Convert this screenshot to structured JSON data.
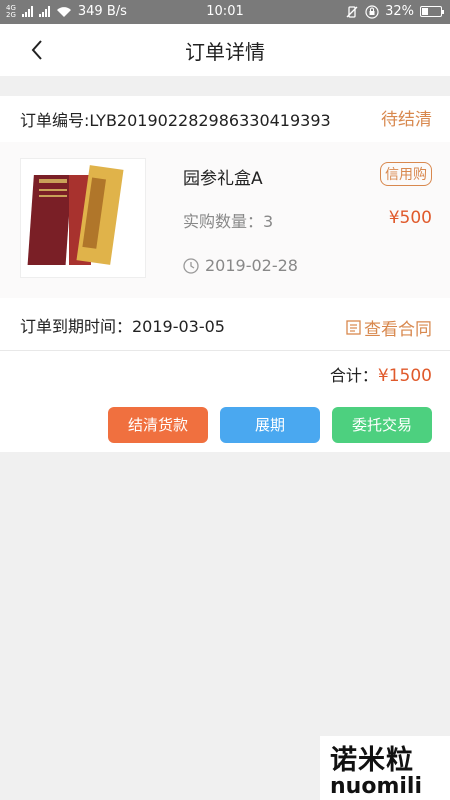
{
  "status_bar": {
    "network_top": "4G",
    "network_bottom": "2G",
    "speed": "349 B/s",
    "time": "10:01",
    "battery": "32%",
    "battery_level": 0.32
  },
  "nav": {
    "title": "订单详情"
  },
  "order": {
    "number_label": "订单编号:LYB20190228298633041939​3",
    "status": "待结清"
  },
  "product": {
    "name": "园参礼盒A",
    "badge": "信用购",
    "quantity": "实购数量：3",
    "price": "¥500",
    "date": "2019-02-28"
  },
  "expire": {
    "label": "订单到期时间：2019-03-05",
    "contract_link": "查看合同"
  },
  "total": {
    "label": "合计：",
    "amount": "¥1500"
  },
  "buttons": {
    "settle": "结清货款",
    "extend": "展期",
    "entrust": "委托交易"
  },
  "colors": {
    "accent": "#d8884e",
    "price": "#e05a2c",
    "settle": "#f0703f",
    "extend": "#4aa8f0",
    "entrust": "#4dd07f"
  },
  "watermark": {
    "cn": "诺米粒",
    "en": "nuomili"
  }
}
